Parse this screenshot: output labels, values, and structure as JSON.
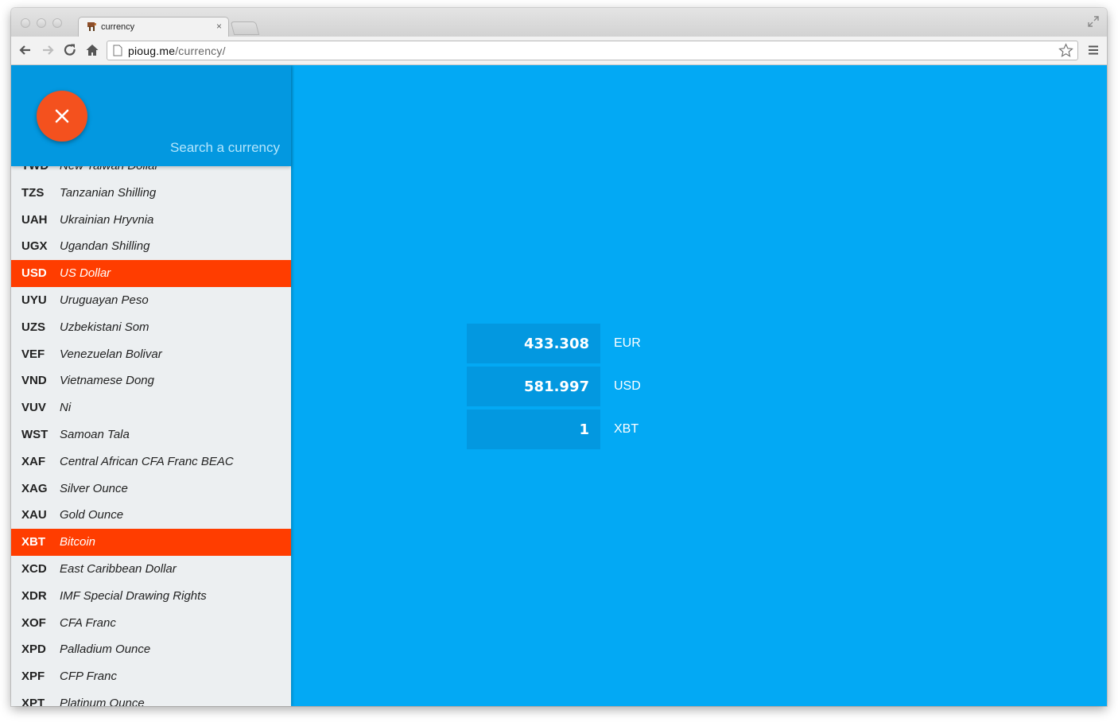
{
  "browser": {
    "tab_title": "currency",
    "tab_close": "×",
    "url_host": "pioug.me",
    "url_path": "/currency/"
  },
  "sidebar": {
    "close_button_icon": "close-icon",
    "search_placeholder": "Search a currency",
    "items": [
      {
        "code": "TWD",
        "name": "New Taiwan Dollar",
        "selected": false
      },
      {
        "code": "TZS",
        "name": "Tanzanian Shilling",
        "selected": false
      },
      {
        "code": "UAH",
        "name": "Ukrainian Hryvnia",
        "selected": false
      },
      {
        "code": "UGX",
        "name": "Ugandan Shilling",
        "selected": false
      },
      {
        "code": "USD",
        "name": "US Dollar",
        "selected": true
      },
      {
        "code": "UYU",
        "name": "Uruguayan Peso",
        "selected": false
      },
      {
        "code": "UZS",
        "name": "Uzbekistani Som",
        "selected": false
      },
      {
        "code": "VEF",
        "name": "Venezuelan Bolivar",
        "selected": false
      },
      {
        "code": "VND",
        "name": "Vietnamese Dong",
        "selected": false
      },
      {
        "code": "VUV",
        "name": "Ni",
        "selected": false
      },
      {
        "code": "WST",
        "name": "Samoan Tala",
        "selected": false
      },
      {
        "code": "XAF",
        "name": "Central African CFA Franc BEAC",
        "selected": false
      },
      {
        "code": "XAG",
        "name": "Silver Ounce",
        "selected": false
      },
      {
        "code": "XAU",
        "name": "Gold Ounce",
        "selected": false
      },
      {
        "code": "XBT",
        "name": "Bitcoin",
        "selected": true
      },
      {
        "code": "XCD",
        "name": "East Caribbean Dollar",
        "selected": false
      },
      {
        "code": "XDR",
        "name": "IMF Special Drawing Rights",
        "selected": false
      },
      {
        "code": "XOF",
        "name": "CFA Franc",
        "selected": false
      },
      {
        "code": "XPD",
        "name": "Palladium Ounce",
        "selected": false
      },
      {
        "code": "XPF",
        "name": "CFP Franc",
        "selected": false
      },
      {
        "code": "XPT",
        "name": "Platinum Ounce",
        "selected": false
      }
    ]
  },
  "conversions": [
    {
      "amount": "433.308",
      "unit": "EUR"
    },
    {
      "amount": "581.997",
      "unit": "USD"
    },
    {
      "amount": "1",
      "unit": "XBT"
    }
  ],
  "colors": {
    "page_background": "#03a9f4",
    "header_background": "#0398e0",
    "accent": "#ff3d00",
    "fab": "#f4511e",
    "list_background": "#eceff1"
  }
}
